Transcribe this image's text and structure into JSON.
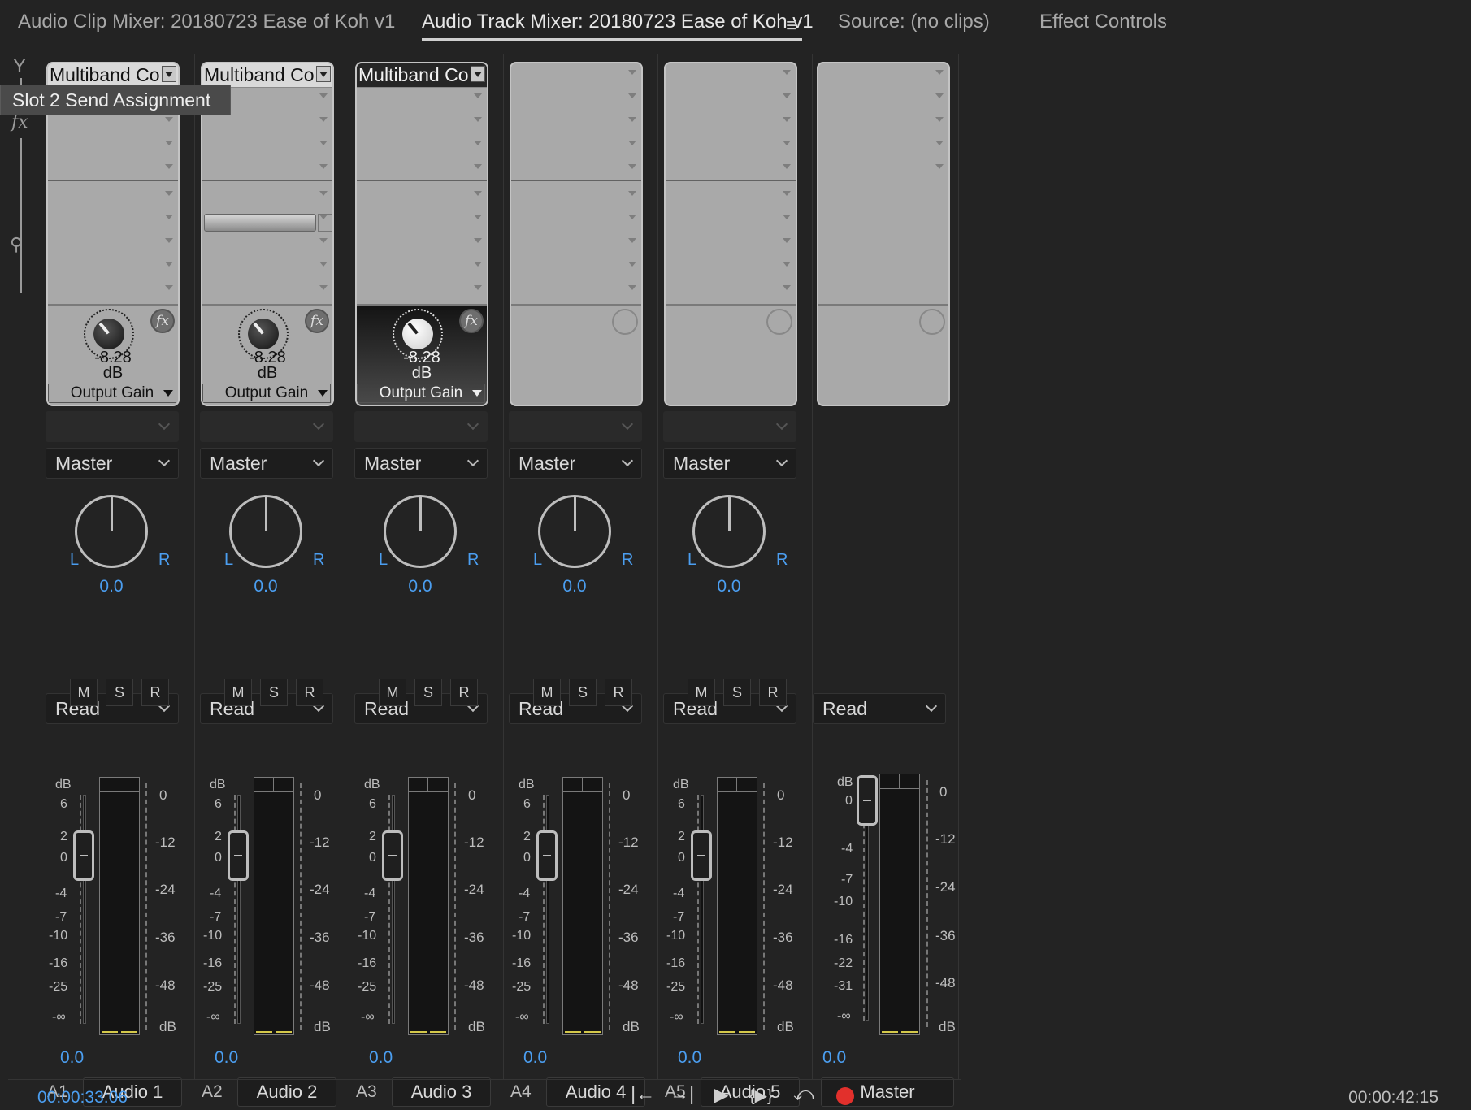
{
  "tabs": [
    {
      "label": "Audio Clip Mixer: 20180723 Ease of Koh v1",
      "active": false
    },
    {
      "label": "Audio Track Mixer: 20180723 Ease of Koh v1",
      "active": true
    },
    {
      "label": "Source: (no clips)",
      "active": false
    },
    {
      "label": "Effect Controls",
      "active": false
    }
  ],
  "menu_icon": "≡",
  "tooltip": "Slot 2 Send Assignment",
  "route_icons": {
    "input": "Y",
    "fx": "fx",
    "send": "⚲"
  },
  "channels": [
    {
      "effect": "Multiband Co",
      "gain_value": "-8.28",
      "gain_unit": "dB",
      "gain_param": "Output Gain",
      "send_bus": "",
      "output": "Master",
      "pan_l": "L",
      "pan_r": "R",
      "pan_value": "0.0",
      "automation": "Read",
      "m": "M",
      "s": "S",
      "r": "R",
      "volume": "0.0",
      "id": "A1",
      "name": "Audio 1"
    },
    {
      "effect": "Multiband Co",
      "gain_value": "-8.28",
      "gain_unit": "dB",
      "gain_param": "Output Gain",
      "send_bus": "",
      "output": "Master",
      "pan_l": "L",
      "pan_r": "R",
      "pan_value": "0.0",
      "automation": "Read",
      "m": "M",
      "s": "S",
      "r": "R",
      "volume": "0.0",
      "id": "A2",
      "name": "Audio 2"
    },
    {
      "effect": "Multiband Co",
      "gain_value": "-8.28",
      "gain_unit": "dB",
      "gain_param": "Output Gain",
      "send_bus": "",
      "output": "Master",
      "pan_l": "L",
      "pan_r": "R",
      "pan_value": "0.0",
      "automation": "Read",
      "m": "M",
      "s": "S",
      "r": "R",
      "volume": "0.0",
      "id": "A3",
      "name": "Audio 3"
    },
    {
      "output": "Master",
      "send_bus": "",
      "pan_l": "L",
      "pan_r": "R",
      "pan_value": "0.0",
      "automation": "Read",
      "m": "M",
      "s": "S",
      "r": "R",
      "volume": "0.0",
      "id": "A4",
      "name": "Audio 4"
    },
    {
      "output": "Master",
      "send_bus": "",
      "pan_l": "L",
      "pan_r": "R",
      "pan_value": "0.0",
      "automation": "Read",
      "m": "M",
      "s": "S",
      "r": "R",
      "volume": "0.0",
      "id": "A5",
      "name": "Audio 5"
    }
  ],
  "master": {
    "automation": "Read",
    "volume": "0.0",
    "name": "Master"
  },
  "fader_scale": [
    "dB",
    "6",
    "2",
    "0",
    "-4",
    "-7",
    "-10",
    "-16",
    "-25",
    "-∞"
  ],
  "master_fader_scale": [
    "dB",
    "0",
    "-4",
    "-7",
    "-10",
    "-16",
    "-22",
    "-31",
    "-∞"
  ],
  "meter_scale": [
    "0",
    "-12",
    "-24",
    "-36",
    "-48",
    "dB"
  ],
  "fx_badge": "fx",
  "transport": {
    "timecode_current": "00:00:33:06",
    "timecode_duration": "00:00:42:15",
    "go_in": "|←",
    "go_out": "→|",
    "play": "▶",
    "loop": "{▶}",
    "loop_back": "⤺"
  },
  "colors": {
    "accent": "#4b9ef0",
    "record": "#e2302c",
    "peak": "#d4c84a"
  }
}
